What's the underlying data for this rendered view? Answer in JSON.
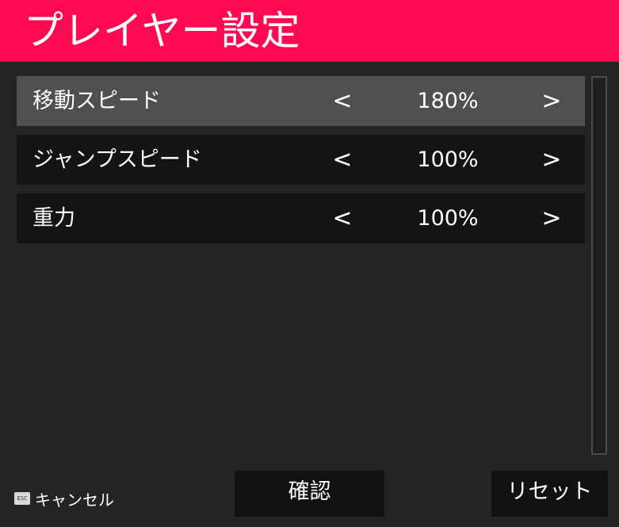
{
  "header": {
    "title": "プレイヤー設定"
  },
  "settings": [
    {
      "label": "移動スピード",
      "value": "180%",
      "left_arrow": "<",
      "right_arrow": ">",
      "selected": true
    },
    {
      "label": "ジャンプスピード",
      "value": "100%",
      "left_arrow": "<",
      "right_arrow": ">",
      "selected": false
    },
    {
      "label": "重力",
      "value": "100%",
      "left_arrow": "<",
      "right_arrow": ">",
      "selected": false
    }
  ],
  "footer": {
    "esc_key": "ESC",
    "cancel_label": "キャンセル",
    "confirm_label": "確認",
    "reset_label": "リセット"
  },
  "colors": {
    "accent": "#ff0a52",
    "background": "#242424",
    "row": "#141414",
    "row_selected": "#505050",
    "button": "#111111"
  }
}
